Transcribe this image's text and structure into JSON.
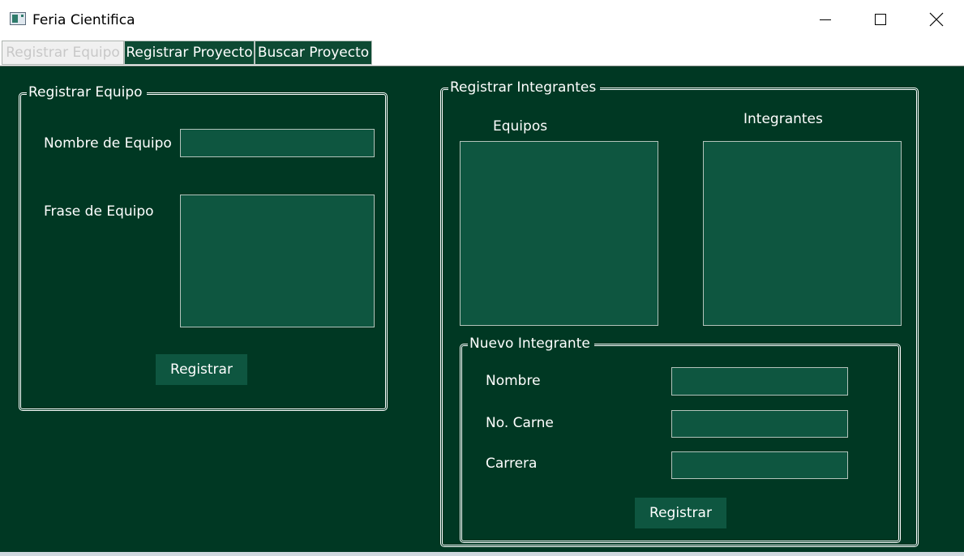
{
  "window": {
    "title": "Feria Cientifica",
    "controls": [
      "minimize-icon",
      "maximize-icon",
      "close-icon"
    ]
  },
  "tabs": [
    {
      "label": "Registrar Equipo",
      "selected": true
    },
    {
      "label": "Registrar Proyecto",
      "selected": false
    },
    {
      "label": "Buscar Proyecto",
      "selected": false
    }
  ],
  "registrar_equipo": {
    "legend": "Registrar Equipo",
    "nombre_label": "Nombre de Equipo",
    "nombre_value": "",
    "frase_label": "Frase de Equipo",
    "frase_value": "",
    "button_label": "Registrar"
  },
  "registrar_integrantes": {
    "legend": "Registrar Integrantes",
    "equipos_label": "Equipos",
    "integrantes_label": "Integrantes",
    "nuevo": {
      "legend": "Nuevo Integrante",
      "nombre_label": "Nombre",
      "nombre_value": "",
      "carne_label": "No. Carne",
      "carne_value": "",
      "carrera_label": "Carrera",
      "carrera_value": "",
      "button_label": "Registrar"
    }
  },
  "colors": {
    "background": "#003823",
    "field": "#0e5640",
    "text": "#ffffff"
  }
}
